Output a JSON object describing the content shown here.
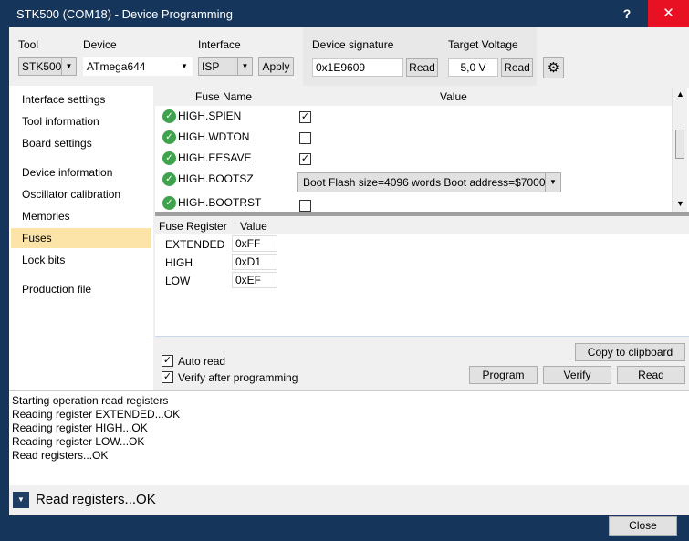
{
  "window": {
    "title": "STK500 (COM18) - Device Programming",
    "help_label": "?",
    "close_label": "✕"
  },
  "toolbar": {
    "tool_label": "Tool",
    "tool_value": "STK500",
    "device_label": "Device",
    "device_value": "ATmega644",
    "interface_label": "Interface",
    "interface_value": "ISP",
    "apply_label": "Apply",
    "signature_label": "Device signature",
    "signature_value": "0x1E9609",
    "signature_read": "Read",
    "voltage_label": "Target Voltage",
    "voltage_value": "5,0 V",
    "voltage_read": "Read",
    "settings_icon": "gear-icon"
  },
  "nav": {
    "items": [
      {
        "label": "Interface settings"
      },
      {
        "label": "Tool information"
      },
      {
        "label": "Board settings"
      },
      {
        "label": "Device information"
      },
      {
        "label": "Oscillator calibration"
      },
      {
        "label": "Memories"
      },
      {
        "label": "Fuses"
      },
      {
        "label": "Lock bits"
      },
      {
        "label": "Production file"
      }
    ],
    "selected": "Fuses"
  },
  "fuses": {
    "col_name": "Fuse Name",
    "col_value": "Value",
    "rows": [
      {
        "name": "HIGH.SPIEN",
        "checked": true
      },
      {
        "name": "HIGH.WDTON",
        "checked": false
      },
      {
        "name": "HIGH.EESAVE",
        "checked": true
      },
      {
        "name": "HIGH.BOOTSZ",
        "value": "Boot Flash size=4096 words Boot address=$7000"
      },
      {
        "name": "HIGH.BOOTRST",
        "checked": false
      }
    ]
  },
  "registers": {
    "col_register": "Fuse Register",
    "col_value": "Value",
    "rows": [
      {
        "name": "EXTENDED",
        "value": "0xFF"
      },
      {
        "name": "HIGH",
        "value": "0xD1"
      },
      {
        "name": "LOW",
        "value": "0xEF"
      }
    ]
  },
  "actions": {
    "auto_read": "Auto read",
    "verify_after": "Verify after programming",
    "copy": "Copy to clipboard",
    "program": "Program",
    "verify": "Verify",
    "read": "Read"
  },
  "log": {
    "lines": [
      "Starting operation read registers",
      "Reading register EXTENDED...OK",
      "Reading register HIGH...OK",
      "Reading register LOW...OK",
      "Read registers...OK"
    ]
  },
  "status": {
    "text": "Read registers...OK"
  },
  "footer": {
    "close": "Close"
  }
}
